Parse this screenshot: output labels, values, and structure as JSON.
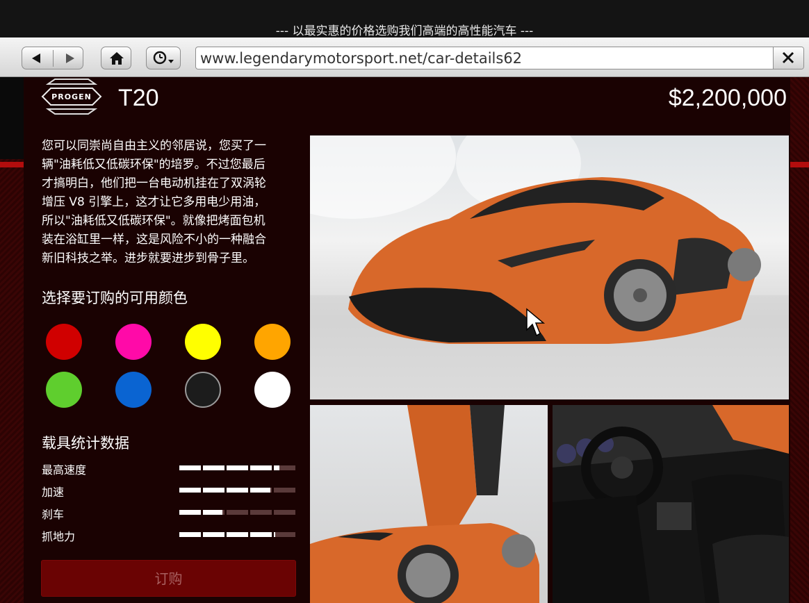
{
  "header": {
    "slogan": "--- 以最实惠的价格选购我们高端的高性能汽车 ---"
  },
  "browser": {
    "url": "www.legendarymotorsport.net/car-details62",
    "back_icon": "back-arrow-icon",
    "forward_icon": "forward-arrow-icon",
    "home_icon": "home-icon",
    "history_icon": "history-clock-icon",
    "close_icon": "close-x-icon"
  },
  "vehicle": {
    "brand_logo": "PROGEN",
    "model": "T20",
    "price": "$2,200,000",
    "description": [
      "您可以同崇尚自由主义的邻居说，您买了一",
      "辆\"油耗低又低碳环保\"的培罗。不过您最后",
      "才搞明白，他们把一台电动机挂在了双涡轮",
      "增压 V8 引擎上，这才让它多用电少用油，",
      "所以\"油耗低又低碳环保\"。就像把烤面包机",
      "装在浴缸里一样，这是风险不小的一种融合",
      "新旧科技之举。进步就要进步到骨子里。"
    ]
  },
  "colors": {
    "heading": "选择要订购的可用颜色",
    "swatches": [
      "#d00000",
      "#ff0aa8",
      "#ffff00",
      "#ffa500",
      "#5fce2e",
      "#0a64d2",
      "#1c1c1c",
      "#ffffff"
    ],
    "selected_index": 6
  },
  "stats": {
    "heading": "载具统计数据",
    "items": [
      {
        "label": "最高速度",
        "value": 0.85
      },
      {
        "label": "加速",
        "value": 0.79
      },
      {
        "label": "刹车",
        "value": 0.38
      },
      {
        "label": "抓地力",
        "value": 0.81
      }
    ]
  },
  "purchase": {
    "label": "订购"
  }
}
